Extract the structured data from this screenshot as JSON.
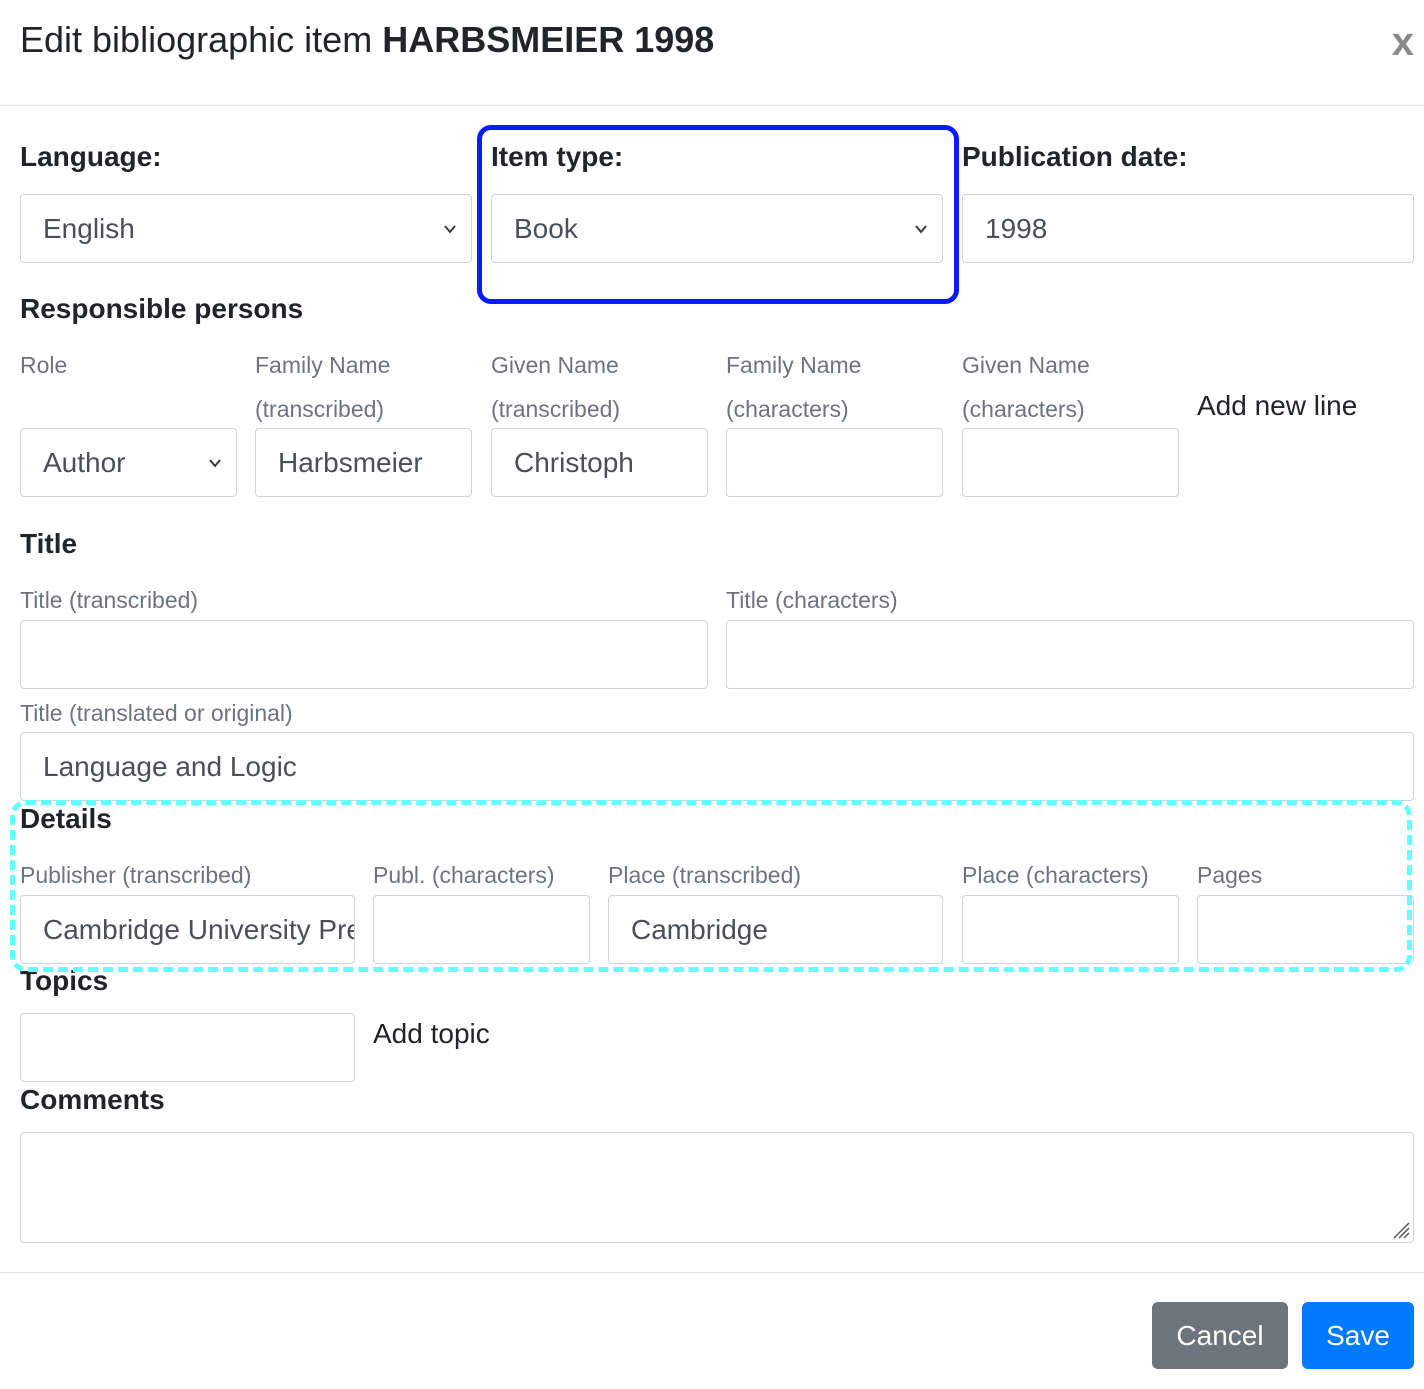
{
  "modal": {
    "title_prefix": "Edit bibliographic item",
    "title_bold": "HARBSMEIER 1998",
    "close_label": "x"
  },
  "language": {
    "label": "Language:",
    "value": "English"
  },
  "item_type": {
    "label": "Item type:",
    "value": "Book"
  },
  "publication_date": {
    "label": "Publication date:",
    "value": "1998"
  },
  "responsible_persons": {
    "heading": "Responsible persons",
    "columns": {
      "role": "Role",
      "family_transcribed_1": "Family Name",
      "family_transcribed_2": "(transcribed)",
      "given_transcribed_1": "Given Name",
      "given_transcribed_2": "(transcribed)",
      "family_characters_1": "Family Name",
      "family_characters_2": "(characters)",
      "given_characters_1": "Given Name",
      "given_characters_2": "(characters)"
    },
    "add_line": "Add new line",
    "row": {
      "role": "Author",
      "family_transcribed": "Harbsmeier",
      "given_transcribed": "Christoph",
      "family_characters": "",
      "given_characters": ""
    }
  },
  "title": {
    "heading": "Title",
    "transcribed_label": "Title (transcribed)",
    "transcribed_value": "",
    "characters_label": "Title (characters)",
    "characters_value": "",
    "translated_label": "Title (translated or original)",
    "translated_value": "Language and Logic"
  },
  "details": {
    "heading": "Details",
    "publisher_transcribed_label": "Publisher (transcribed)",
    "publisher_transcribed_value": "Cambridge University Press",
    "publisher_characters_label": "Publ. (characters)",
    "publisher_characters_value": "",
    "place_transcribed_label": "Place (transcribed)",
    "place_transcribed_value": "Cambridge",
    "place_characters_label": "Place (characters)",
    "place_characters_value": "",
    "pages_label": "Pages",
    "pages_value": ""
  },
  "topics": {
    "heading": "Topics",
    "value": "",
    "add_label": "Add topic"
  },
  "comments": {
    "heading": "Comments",
    "value": ""
  },
  "footer": {
    "cancel_label": "Cancel",
    "save_label": "Save"
  },
  "colors": {
    "primary": "#007bff",
    "secondary": "#6c757d",
    "highlight_blue": "#0a1cff",
    "highlight_cyan": "#66ffff"
  },
  "icons": {
    "close": "close-icon",
    "select_arrow": "chevron-down-icon",
    "textarea_resize": "resize-grip-icon"
  }
}
